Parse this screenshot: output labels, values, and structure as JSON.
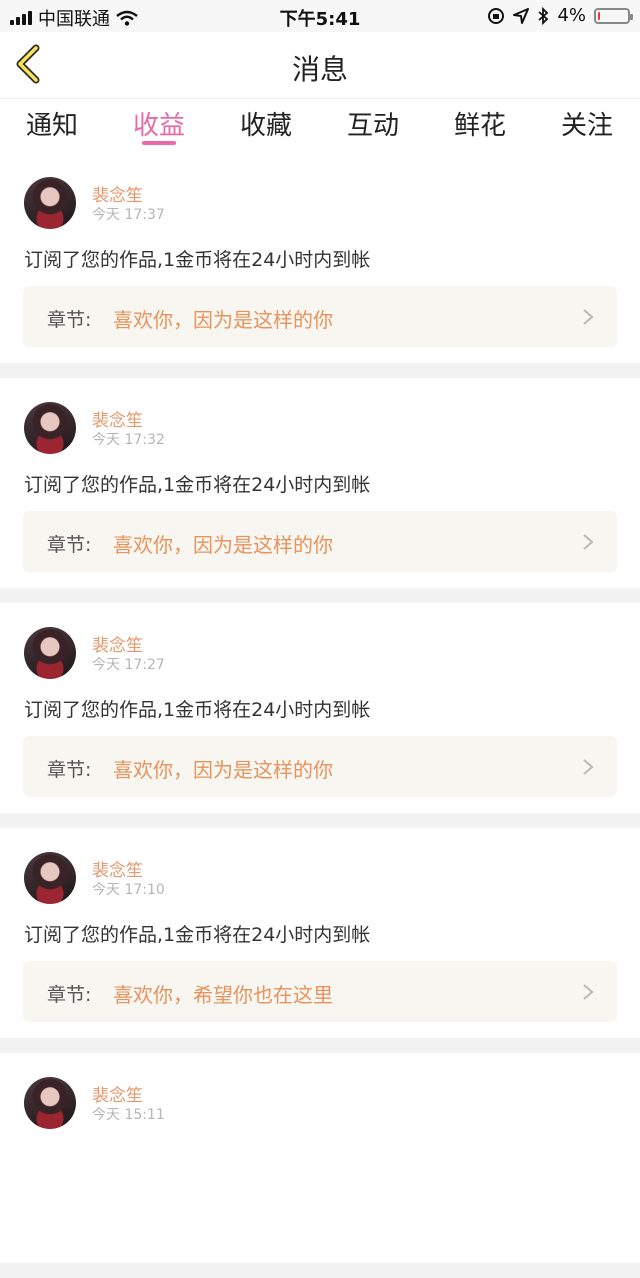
{
  "status_bar": {
    "carrier": "中国联通",
    "time": "下午5:41",
    "battery": "4%",
    "battery_level": 0.04
  },
  "header": {
    "title": "消息"
  },
  "tabs": [
    {
      "label": "通知",
      "active": false
    },
    {
      "label": "收益",
      "active": true
    },
    {
      "label": "收藏",
      "active": false
    },
    {
      "label": "互动",
      "active": false
    },
    {
      "label": "鲜花",
      "active": false
    },
    {
      "label": "关注",
      "active": false
    }
  ],
  "feed": [
    {
      "name": "裴念笙",
      "time": "今天 17:37",
      "message": "订阅了您的作品,1金币将在24小时内到帐",
      "chapter_label": "章节:",
      "chapter_title": "喜欢你，因为是这样的你"
    },
    {
      "name": "裴念笙",
      "time": "今天 17:32",
      "message": "订阅了您的作品,1金币将在24小时内到帐",
      "chapter_label": "章节:",
      "chapter_title": "喜欢你，因为是这样的你"
    },
    {
      "name": "裴念笙",
      "time": "今天 17:27",
      "message": "订阅了您的作品,1金币将在24小时内到帐",
      "chapter_label": "章节:",
      "chapter_title": "喜欢你，因为是这样的你"
    },
    {
      "name": "裴念笙",
      "time": "今天 17:10",
      "message": "订阅了您的作品,1金币将在24小时内到帐",
      "chapter_label": "章节:",
      "chapter_title": "喜欢你，希望你也在这里"
    },
    {
      "name": "裴念笙",
      "time": "今天 15:11",
      "message": "",
      "chapter_label": "",
      "chapter_title": ""
    }
  ]
}
